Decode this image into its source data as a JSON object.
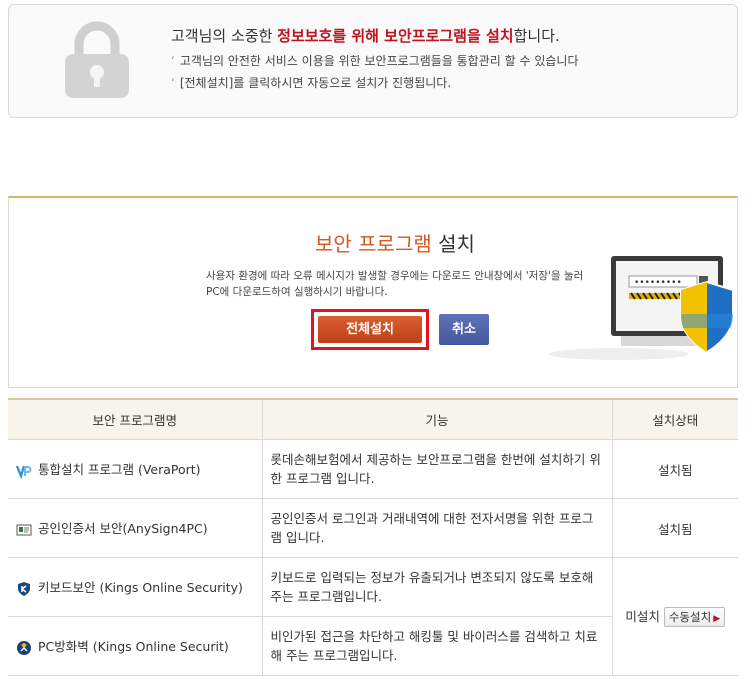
{
  "notice": {
    "title_prefix": "고객님의 소중한 ",
    "title_highlight": "정보보호를 위해 보안프로그램을 설치",
    "title_suffix": "합니다.",
    "line1": "고객님의 안전한 서비스 이용을 위한 보안프로그램들을 통합관리 할 수 있습니다",
    "line2": "[전체설치]를 클릭하시면 자동으로 설치가 진행됩니다."
  },
  "install": {
    "title_accent": "보안 프로그램",
    "title_rest": " 설치",
    "desc_line1": "사용자 환경에 따라 오류 메시지가 발생할 경우에는 다운로드 안내창에서 '저장'을 눌러",
    "desc_line2": "PC에 다운로드하여 실행하시기 바랍니다.",
    "install_all_label": "전체설치",
    "cancel_label": "취소",
    "password_mask": "•••••••••"
  },
  "table": {
    "headers": [
      "보안 프로그램명",
      "기능",
      "설치상태"
    ],
    "rows": [
      {
        "icon": "veraport-icon",
        "name": "통합설치 프로그램 (VeraPort)",
        "desc": "롯데손해보험에서 제공하는 보안프로그램을 한번에 설치하기 위한 프로그램 입니다.",
        "status": "설치됨"
      },
      {
        "icon": "anysign-icon",
        "name": "공인인증서 보안(AnySign4PC)",
        "desc": "공인인증서 로그인과 거래내역에 대한 전자서명을 위한 프로그램 입니다.",
        "status": "설치됨"
      },
      {
        "icon": "kings-keyboard-icon",
        "name": "키보드보안 (Kings Online Security)",
        "desc": "키보드로 입력되는 정보가 유출되거나 변조되지 않도록 보호해 주는 프로그램입니다."
      },
      {
        "icon": "kings-firewall-icon",
        "name": "PC방화벽 (Kings Online Securit)",
        "desc": "비인가된 접근을 차단하고 해킹툴 및 바이러스를 검색하고 치료해 주는 프로그램입니다."
      }
    ],
    "shared_status": "미설치",
    "manual_install_label": "수동설치"
  },
  "colors": {
    "highlight_red": "#c1121f",
    "accent_orange": "#d4581c",
    "install_button": "#c9481f",
    "cancel_button": "#4d61a6",
    "focus_border": "#e4151a"
  }
}
